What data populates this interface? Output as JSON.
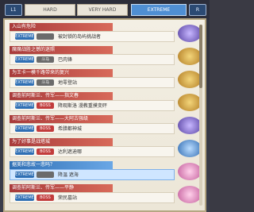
{
  "tabs": {
    "left_corner": "L1",
    "right_corner": "R",
    "items": [
      "HARD",
      "VERY HARD",
      "EXTREME"
    ],
    "active_index": 2
  },
  "rows": [
    {
      "title": "入山有危险 ",
      "difficulty": "EXTREME",
      "mode": "",
      "stage": "被封锁的岛屿挑战者",
      "reward_color": "purple",
      "reward_tag": ""
    },
    {
      "title": "魔魔战胜之憾的迷照",
      "difficulty": "EXTREME",
      "mode": "斗马",
      "stage": "巴肉锋",
      "reward_color": "gold",
      "reward_tag": ""
    },
    {
      "title": "为王卡一模千路带来的复兴",
      "difficulty": "EXTREME",
      "mode": "斗马",
      "stage": "地零登站",
      "reward_color": "gold",
      "reward_tag": ""
    },
    {
      "title": "调查前阿斯兰、传军——指文春",
      "difficulty": "EXTREME",
      "mode": "BOSS",
      "stage": "降观斯洛 漫教重摸变砰",
      "reward_color": "gold",
      "reward_tag": ""
    },
    {
      "title": "调查前阿斯兰、传军——大阿古强级",
      "difficulty": "EXTREME",
      "mode": "BOSS",
      "stage": "希腊都神城",
      "reward_color": "purple",
      "reward_tag": ""
    },
    {
      "title": "为了好事是战塔城",
      "difficulty": "EXTREME",
      "mode": "BOSS",
      "stage": "达利遮迪哪",
      "reward_color": "blue",
      "reward_tag": ""
    },
    {
      "title": "据美和悲故一悲吗？",
      "difficulty": "EXTREME",
      "mode": "",
      "stage": "降温 遮海",
      "reward_color": "pink",
      "reward_tag": ""
    },
    {
      "title": "调查前阿斯兰、传军——平静",
      "difficulty": "EXTREME",
      "mode": "BOSS",
      "stage": "荣民墓站",
      "reward_color": "pink",
      "reward_tag": ""
    }
  ],
  "selected_row": 6
}
